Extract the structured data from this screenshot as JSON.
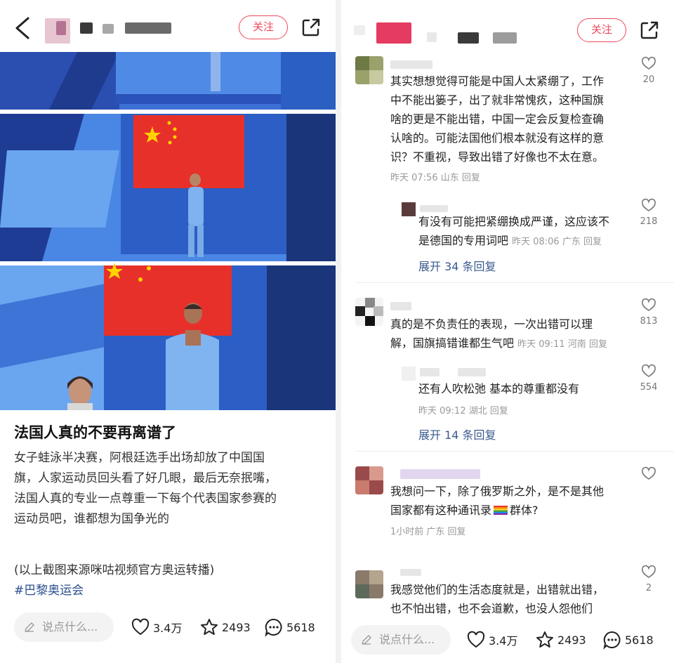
{
  "left": {
    "header": {
      "follow_label": "关注"
    },
    "post": {
      "title": "法国人真的不要再离谱了",
      "body_lines": [
        "女子蛙泳半决赛，阿根廷选手出场却放了中国国",
        "旗，人家运动员回头看了好几眼，最后无奈抿嘴，",
        "法国人真的专业一点尊重一下每个代表国家参赛的",
        "运动员吧，谁都想为国争光的"
      ],
      "source": "(以上截图来源咪咕视频官方奥运转播)",
      "hashtag": "#巴黎奥运会"
    },
    "bottom": {
      "comment_placeholder": "说点什么...",
      "likes": "3.4万",
      "favorites": "2493",
      "comments": "5618"
    }
  },
  "right": {
    "header": {
      "follow_label": "关注"
    },
    "comments": [
      {
        "lines": [
          "其实想想觉得可能是中国人太紧绷了，工作",
          "中不能出篓子，出了就非常愧疚，这种国旗",
          "啥的更是不能出错，中国一定会反复检查确",
          "认啥的。可能法国他们根本就没有这样的意",
          "识？不重视，导致出错了好像也不太在意。"
        ],
        "meta": "昨天 07:56 山东 回复",
        "likes": "20"
      },
      {
        "lines": [
          "有没有可能把紧绷换成严谨，这应该不",
          "是德国的专用词吧"
        ],
        "meta": "昨天 08:06 广东 回复",
        "likes": "218",
        "expand": "展开 34 条回复"
      },
      {
        "lines": [
          "真的是不负责任的表现，一次出错可以理",
          "解，国旗搞错谁都生气吧"
        ],
        "meta": "昨天 09:11 河南 回复",
        "likes": "813"
      },
      {
        "lines": [
          "还有人吹松弛 基本的尊重都没有"
        ],
        "meta": "昨天 09:12 湖北 回复",
        "likes": "554",
        "expand": "展开 14 条回复"
      },
      {
        "lines": [
          "我想问一下，除了俄罗斯之外，是不是其他",
          "国家都有这种通讯录",
          "群体?"
        ],
        "meta": "1小时前 广东 回复",
        "likes": ""
      },
      {
        "lines": [
          "我感觉他们的生活态度就是，出错就出错，",
          "也不怕出错，也不会道歉，也没人怨他们"
        ],
        "meta": "",
        "likes": "2"
      }
    ],
    "bottom": {
      "comment_placeholder": "说点什么...",
      "likes": "3.4万",
      "favorites": "2493",
      "comments": "5618"
    }
  },
  "colors": {
    "accent": "#f0485c",
    "link": "#3a5a8f",
    "hashtag": "#2c4f8f",
    "flag_red": "#e8302a",
    "flag_star": "#ffd400"
  }
}
